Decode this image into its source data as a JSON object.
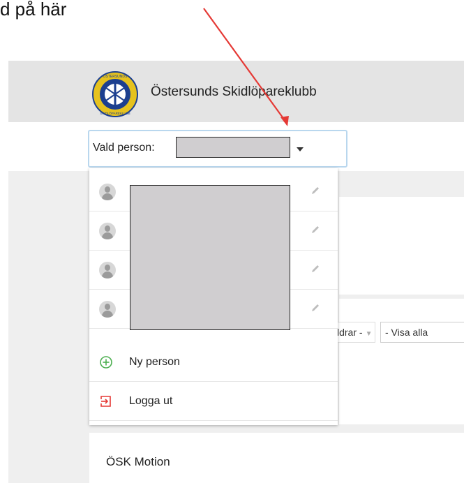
{
  "caption": "d på här",
  "header": {
    "club_name": "Östersunds Skidlöpareklubb",
    "logo_text_top": "ÖSTERSUNDS",
    "logo_text_bottom": "SKIDLÖPAREKLUBB"
  },
  "person_select": {
    "label": "Vald person:",
    "selected_value": ""
  },
  "dropdown": {
    "people": [
      {
        "name": ""
      },
      {
        "name": ""
      },
      {
        "name": ""
      },
      {
        "name": ""
      }
    ],
    "new_person_label": "Ny person",
    "logout_label": "Logga ut"
  },
  "filters": {
    "parents_label": "ldrar -",
    "show_all_label": "- Visa alla"
  },
  "motion_card": {
    "title": "ÖSK Motion"
  },
  "colors": {
    "header_bg": "#e4e4e4",
    "select_border": "#b9d7ee",
    "new_person_icon": "#4caf50",
    "logout_icon": "#e53935",
    "annotation_arrow": "#e53935"
  },
  "icons": {
    "avatar": "person-silhouette-icon",
    "edit": "pencil-icon",
    "new_person": "plus-circle-icon",
    "logout": "logout-icon",
    "caret": "chevron-down-icon"
  }
}
